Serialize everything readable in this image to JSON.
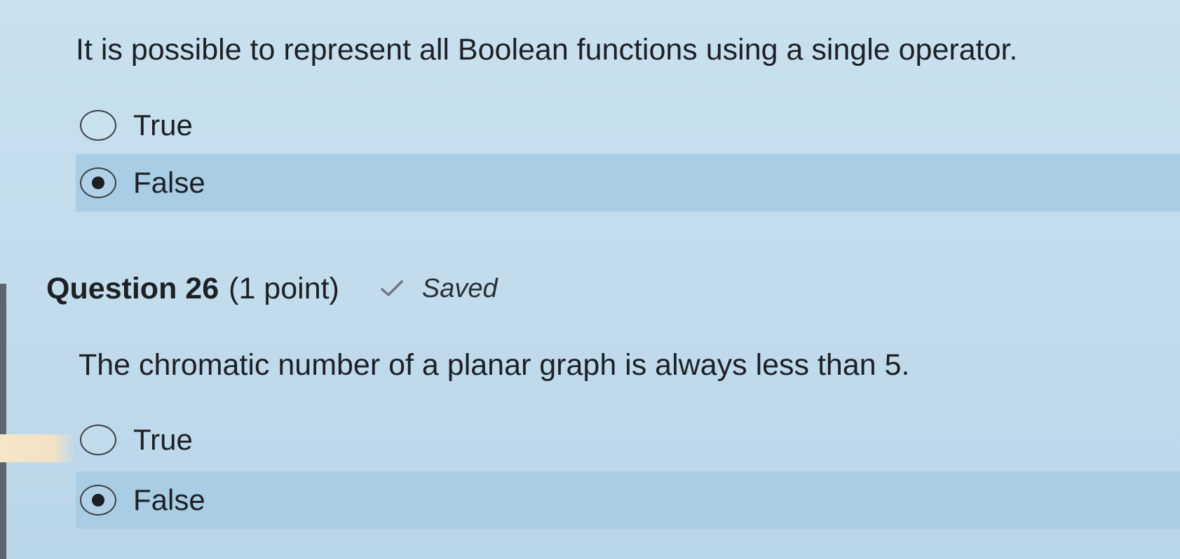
{
  "questions": [
    {
      "text": "It is  possible to represent all Boolean functions using a single operator.",
      "options": [
        {
          "label": "True",
          "selected": false
        },
        {
          "label": "False",
          "selected": true
        }
      ]
    },
    {
      "title": "Question 26",
      "points": "(1 point)",
      "status": "Saved",
      "status_icon": "checkmark-icon",
      "text": "The chromatic number of a planar graph is always less than 5.",
      "options": [
        {
          "label": "True",
          "selected": false
        },
        {
          "label": "False",
          "selected": true
        }
      ]
    }
  ],
  "colors": {
    "background": "#c2dcec",
    "selected_row": "#a9cde4",
    "text": "#1d2126",
    "check": "#6f7880"
  }
}
